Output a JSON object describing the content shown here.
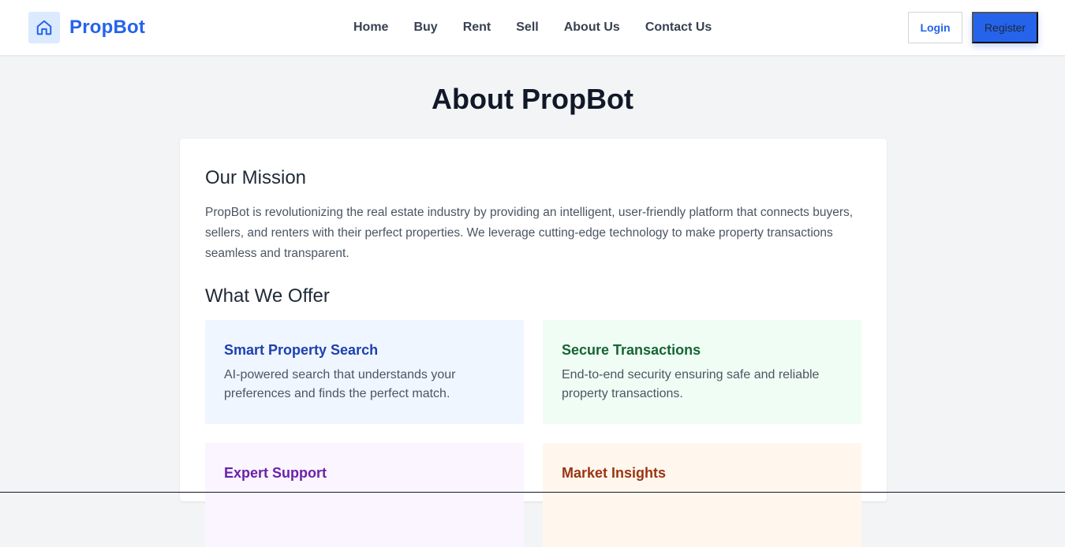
{
  "brand": {
    "name": "PropBot",
    "icon": "home-icon"
  },
  "nav": {
    "links": [
      "Home",
      "Buy",
      "Rent",
      "Sell",
      "About Us",
      "Contact Us"
    ]
  },
  "auth": {
    "login_label": "Login",
    "register_label": "Register"
  },
  "page": {
    "title": "About PropBot"
  },
  "mission": {
    "heading": "Our Mission",
    "text": "PropBot is revolutionizing the real estate industry by providing an intelligent, user-friendly platform that connects buyers, sellers, and renters with their perfect properties. We leverage cutting-edge technology to make property transactions seamless and transparent."
  },
  "offer": {
    "heading": "What We Offer",
    "items": [
      {
        "title": "Smart Property Search",
        "description": "AI-powered search that understands your preferences and finds the perfect match."
      },
      {
        "title": "Secure Transactions",
        "description": "End-to-end security ensuring safe and reliable property transactions."
      },
      {
        "title": "Expert Support",
        "description": ""
      },
      {
        "title": "Market Insights",
        "description": ""
      }
    ]
  },
  "colors": {
    "accent": "#2563eb",
    "search_bg": "#eff6ff",
    "transactions_bg": "#f0fdf4",
    "support_bg": "#faf5ff",
    "insights_bg": "#fff7ed"
  }
}
